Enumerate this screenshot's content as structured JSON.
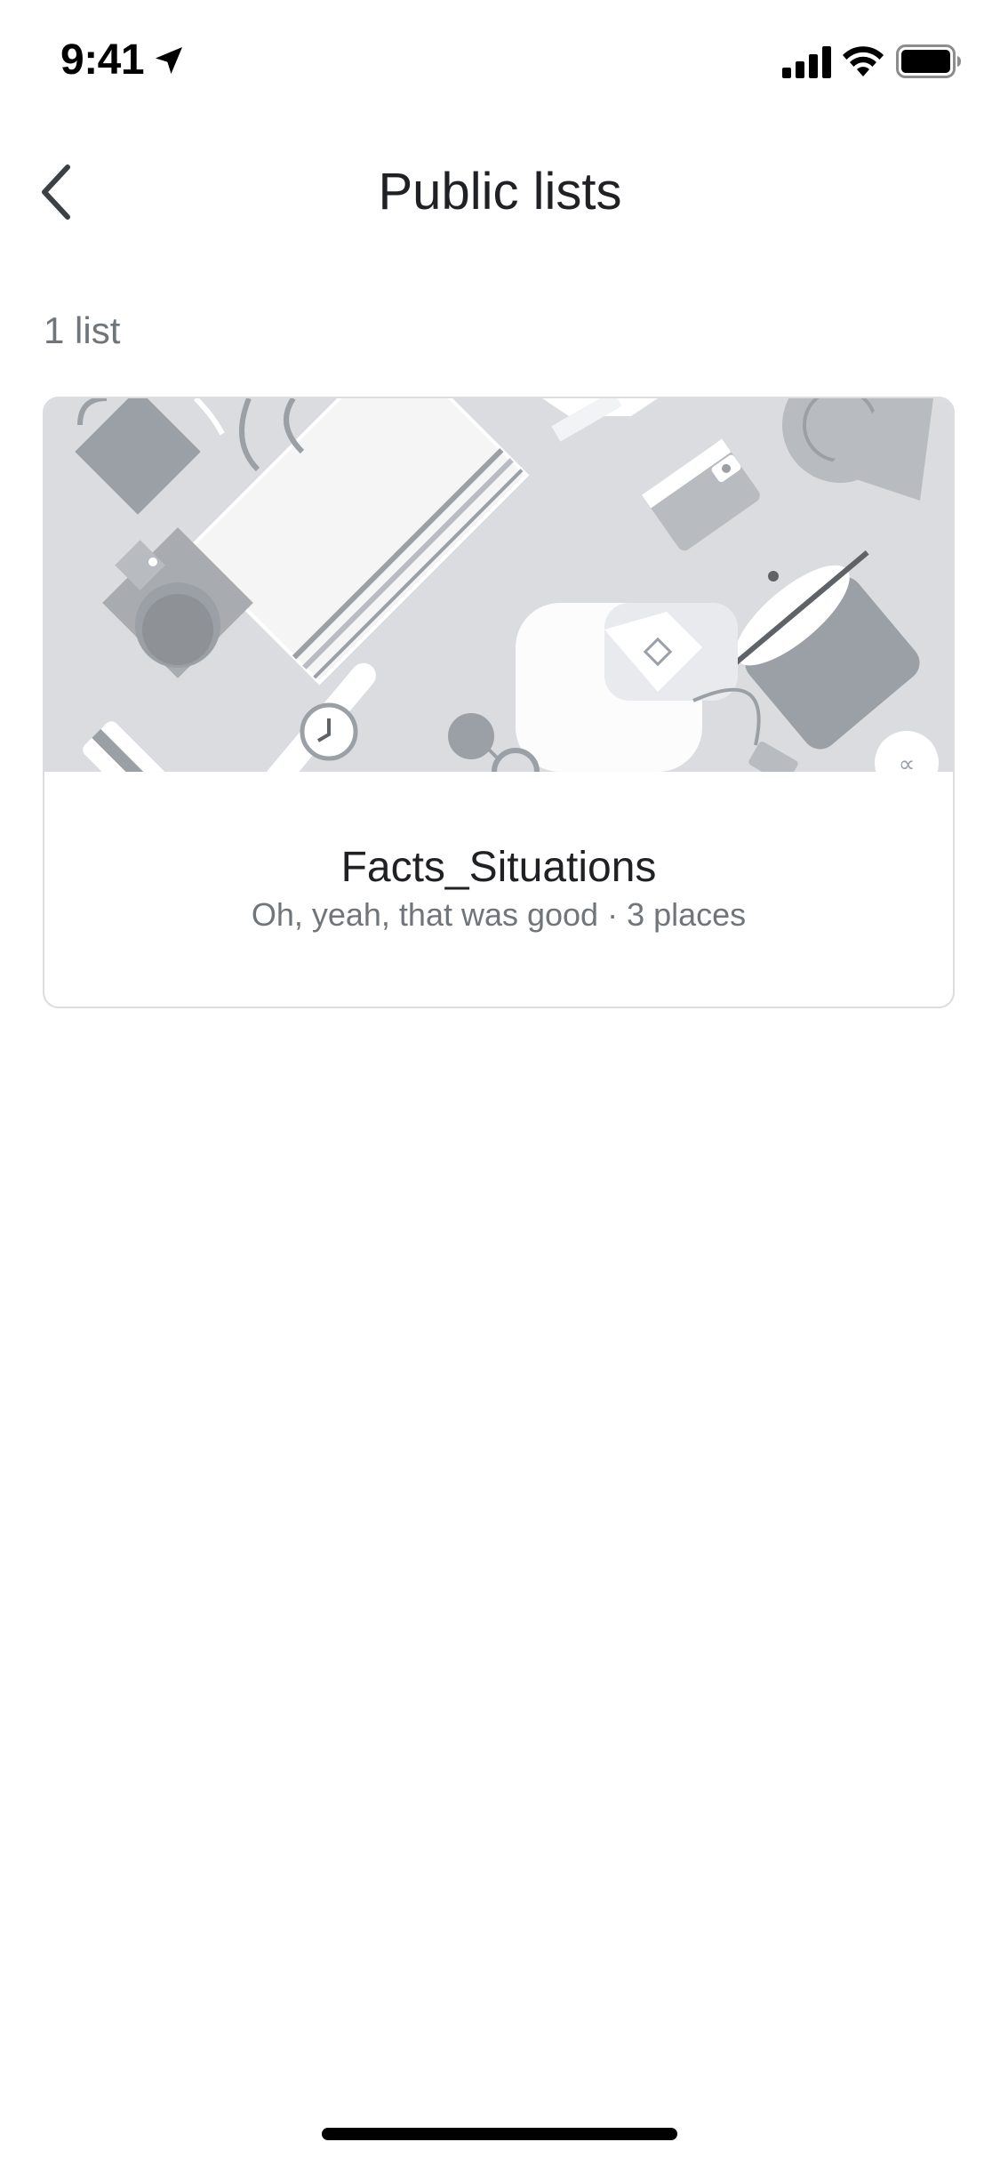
{
  "status_bar": {
    "time": "9:41",
    "icons": [
      "location-arrow-icon",
      "cellular-signal-icon",
      "wifi-icon",
      "battery-icon"
    ]
  },
  "header": {
    "back_icon": "chevron-left-icon",
    "title": "Public lists"
  },
  "list_count": "1 list",
  "lists": [
    {
      "title": "Facts_Situations",
      "subtitle": "Oh, yeah, that was good · 3 places",
      "cover_image": "travel-items-illustration"
    }
  ],
  "colors": {
    "title_text": "#202124",
    "secondary_text": "#70757a",
    "card_border": "#dadce0",
    "illustration_bg": "#dadcdf"
  }
}
